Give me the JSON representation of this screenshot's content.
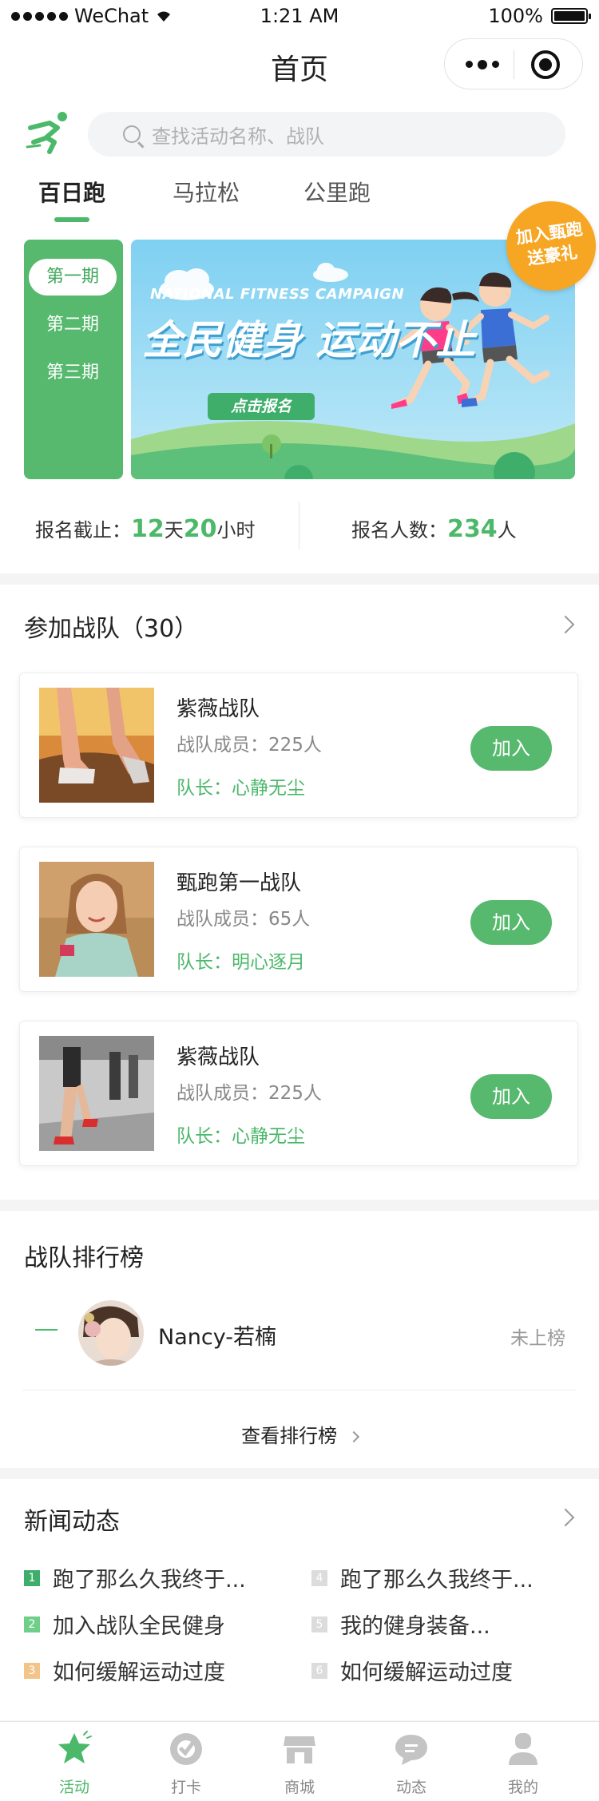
{
  "status_bar": {
    "carrier": "WeChat",
    "time": "1:21 AM",
    "battery": "100%"
  },
  "nav": {
    "title": "首页"
  },
  "search": {
    "placeholder": "查找活动名称、战队"
  },
  "tabs": [
    {
      "label": "百日跑",
      "active": true
    },
    {
      "label": "马拉松",
      "active": false
    },
    {
      "label": "公里跑",
      "active": false
    }
  ],
  "periods": [
    {
      "label": "第一期",
      "active": true
    },
    {
      "label": "第二期",
      "active": false
    },
    {
      "label": "第三期",
      "active": false
    }
  ],
  "banner": {
    "subtitle": "NATIONAL FITNESS CAMPAIGN",
    "title": "全民健身 运动不止",
    "button": "点击报名",
    "badge_line1": "加入甄跑",
    "badge_line2": "送豪礼"
  },
  "stats": {
    "deadline_label": "报名截止：",
    "days": "12",
    "days_unit": "天",
    "hours": "20",
    "hours_unit": "小时",
    "count_label": "报名人数：",
    "count": "234",
    "count_unit": "人"
  },
  "teams_section": {
    "title": "参加战队（30）",
    "teams": [
      {
        "name": "紫薇战队",
        "members": "战队成员：225人",
        "captain": "队长：心静无尘",
        "join": "加入"
      },
      {
        "name": "甄跑第一战队",
        "members": "战队成员：65人",
        "captain": "队长：明心逐月",
        "join": "加入"
      },
      {
        "name": "紫薇战队",
        "members": "战队成员：225人",
        "captain": "队长：心静无尘",
        "join": "加入"
      }
    ]
  },
  "ranking": {
    "title": "战队排行榜",
    "rank": "—",
    "name": "Nancy-若楠",
    "status": "未上榜",
    "more": "查看排行榜"
  },
  "news": {
    "title": "新闻动态",
    "items": [
      {
        "num": "1",
        "text": "跑了那么久我终于..."
      },
      {
        "num": "4",
        "text": "跑了那么久我终于..."
      },
      {
        "num": "2",
        "text": "加入战队全民健身"
      },
      {
        "num": "5",
        "text": "我的健身装备..."
      },
      {
        "num": "3",
        "text": "如何缓解运动过度"
      },
      {
        "num": "6",
        "text": "如何缓解运动过度"
      }
    ]
  },
  "tabbar": [
    {
      "label": "活动",
      "icon": "star-icon",
      "active": true
    },
    {
      "label": "打卡",
      "icon": "checkin-icon",
      "active": false
    },
    {
      "label": "商城",
      "icon": "store-icon",
      "active": false
    },
    {
      "label": "动态",
      "icon": "chat-icon",
      "active": false
    },
    {
      "label": "我的",
      "icon": "user-icon",
      "active": false
    }
  ],
  "colors": {
    "accent": "#56b96d",
    "badge": "#f6a622"
  }
}
